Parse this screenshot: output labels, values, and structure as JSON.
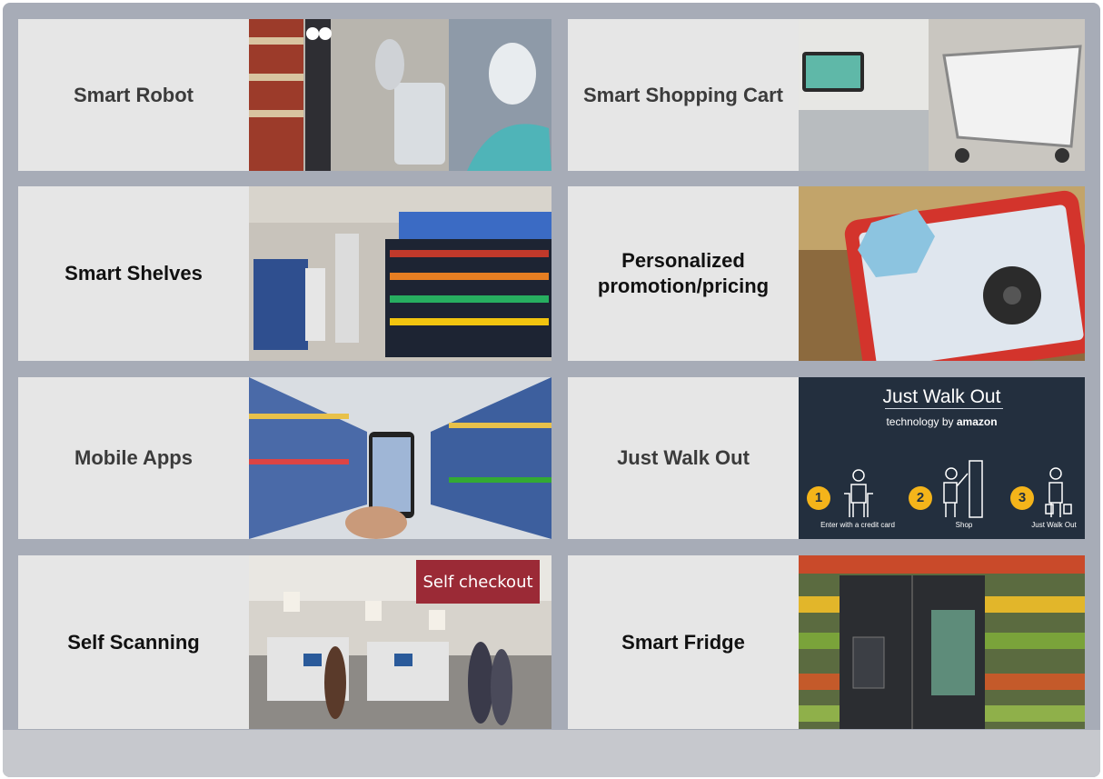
{
  "cards": [
    {
      "label": "Smart Robot"
    },
    {
      "label": "Smart Shopping Cart"
    },
    {
      "label": "Smart Shelves"
    },
    {
      "label": "Personalized promotion/pricing"
    },
    {
      "label": "Mobile Apps"
    },
    {
      "label": "Just Walk Out"
    },
    {
      "label": "Self Scanning"
    },
    {
      "label": "Smart Fridge"
    }
  ],
  "just_walk_out_image": {
    "title": "Just Walk Out",
    "subtitle_prefix": "technology by",
    "subtitle_brand": "amazon",
    "steps": [
      {
        "number": "1",
        "caption": "Enter with a credit card"
      },
      {
        "number": "2",
        "caption": "Shop"
      },
      {
        "number": "3",
        "caption": "Just Walk Out"
      }
    ]
  },
  "self_checkout_sign": "Self checkout",
  "colors": {
    "background": "#a7acb7",
    "label_bg": "#e6e6e6",
    "amazon_navy": "#232f3e",
    "amazon_yellow": "#f4b41a"
  }
}
